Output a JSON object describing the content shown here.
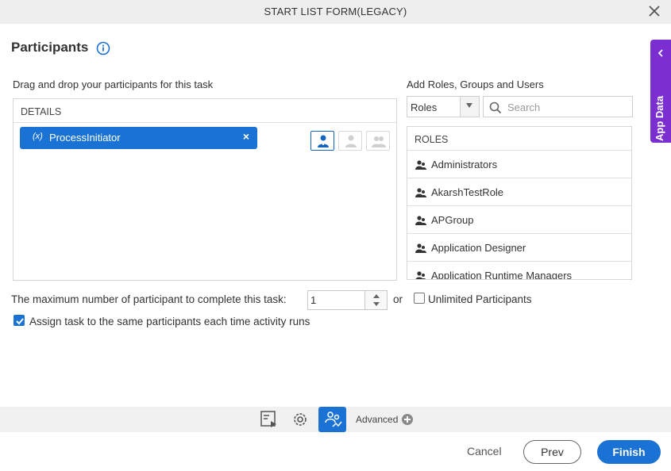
{
  "window": {
    "title": "START LIST FORM(LEGACY)"
  },
  "heading": "Participants",
  "app_data_tab": {
    "label": "App Data"
  },
  "details": {
    "instruction": "Drag and drop your participants for this task",
    "header": "DETAILS",
    "participant": {
      "var_marker": "(x)",
      "name": "ProcessInitiator",
      "remove": "×"
    }
  },
  "add_panel": {
    "label": "Add Roles, Groups and Users",
    "type_select": "Roles",
    "search_placeholder": "Search",
    "list_header": "ROLES",
    "roles": [
      "Administrators",
      "AkarshTestRole",
      "APGroup",
      "Application Designer",
      "Application Runtime Managers"
    ]
  },
  "options": {
    "max_label": "The maximum number of participant to complete this task:",
    "max_value": "1",
    "or": "or",
    "unlimited_label": "Unlimited Participants",
    "unlimited_checked": false,
    "assign_label": "Assign task to the same participants each time activity runs",
    "assign_checked": true
  },
  "toolbar": {
    "advanced_label": "Advanced"
  },
  "footer": {
    "cancel": "Cancel",
    "prev": "Prev",
    "finish": "Finish"
  },
  "colors": {
    "primary": "#1a73d4",
    "app_data": "#7b2fd0"
  }
}
